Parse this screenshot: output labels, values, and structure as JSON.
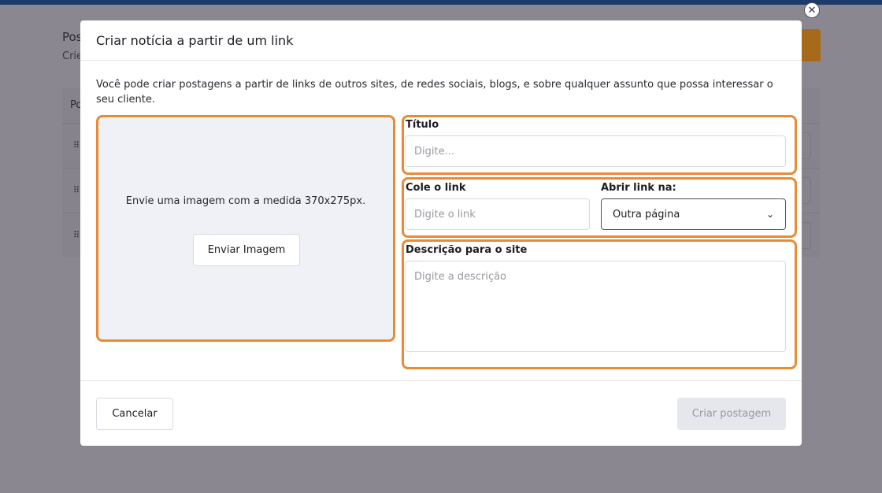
{
  "background": {
    "page_title_partial": "Pos",
    "page_subtitle_partial": "Crie",
    "table_header_partial": "Po",
    "grip_glyph": "⠿"
  },
  "modal": {
    "title": "Criar notícia a partir de um link",
    "intro": "Você pode criar postagens a partir de links de outros sites, de redes sociais, blogs, e sobre qualquer assunto que possa interessar o seu cliente.",
    "close_glyph": "✕",
    "upload": {
      "text": "Envie uma imagem com a medida 370x275px.",
      "button_label": "Enviar Imagem"
    },
    "fields": {
      "title_label": "Título",
      "title_placeholder": "Digite...",
      "link_label": "Cole o link",
      "link_placeholder": "Digite o link",
      "open_link_label": "Abrir link na:",
      "open_link_value": "Outra página",
      "description_label": "Descrição para o site",
      "description_placeholder": "Digite a descrição"
    },
    "footer": {
      "cancel_label": "Cancelar",
      "create_label": "Criar postagem"
    }
  },
  "colors": {
    "highlight": "#e88b35",
    "overlay": "#8b8791",
    "topbar": "#1d3a6b"
  }
}
